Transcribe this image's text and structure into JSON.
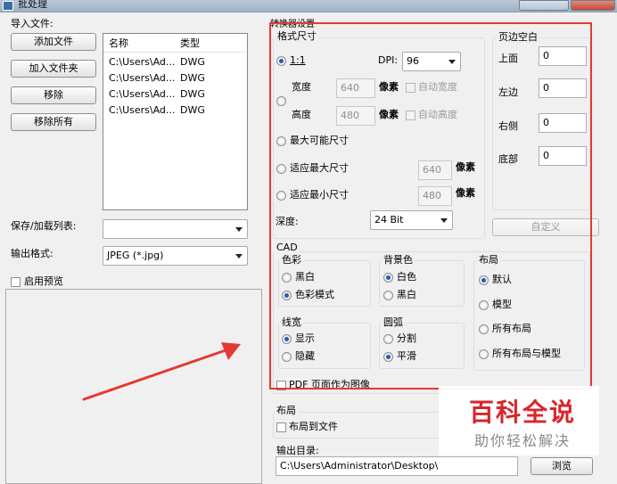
{
  "window": {
    "title": "批处理"
  },
  "left": {
    "import_label": "导入文件:",
    "buttons": {
      "add_file": "添加文件",
      "add_folder": "加入文件夹",
      "remove": "移除",
      "remove_all": "移除所有"
    },
    "list_headers": {
      "name": "名称",
      "type": "类型"
    },
    "files": [
      {
        "name": "C:\\Users\\Ad...",
        "type": "DWG"
      },
      {
        "name": "C:\\Users\\Ad...",
        "type": "DWG"
      },
      {
        "name": "C:\\Users\\Ad...",
        "type": "DWG"
      },
      {
        "name": "C:\\Users\\Ad...",
        "type": "DWG"
      }
    ],
    "save_load_label": "保存/加载列表:",
    "save_load_value": "",
    "output_format_label": "输出格式:",
    "output_format_value": "JPEG (*.jpg)",
    "enable_preview_label": "启用预览"
  },
  "converter": {
    "title": "转换器设置",
    "format_size": {
      "label": "格式尺寸",
      "ratio_label": "1:1",
      "dpi_label": "DPI:",
      "dpi_value": "96",
      "width_label": "宽度",
      "width_value": "640",
      "height_label": "高度",
      "height_value": "480",
      "pixel_label": "像素",
      "auto_width_label": "自动宽度",
      "auto_height_label": "自动高度",
      "max_possible_label": "最大可能尺寸",
      "fit_max_label": "适应最大尺寸",
      "fit_max_value": "640",
      "fit_min_label": "适应最小尺寸",
      "fit_min_value": "480",
      "depth_label": "深度:",
      "depth_value": "24 Bit"
    },
    "margins": {
      "label": "页边空白",
      "top_label": "上面",
      "top_value": "0",
      "left_label": "左边",
      "left_value": "0",
      "right_label": "右侧",
      "right_value": "0",
      "bottom_label": "底部",
      "bottom_value": "0",
      "custom_button": "自定义"
    },
    "cad": {
      "label": "CAD",
      "color": {
        "label": "色彩",
        "options": [
          "黑白",
          "色彩模式"
        ]
      },
      "background": {
        "label": "背景色",
        "options": [
          "白色",
          "黑白"
        ]
      },
      "layout": {
        "label": "布局",
        "options": [
          "默认",
          "模型",
          "所有布局",
          "所有布局与模型"
        ]
      },
      "lineweight": {
        "label": "线宽",
        "options": [
          "显示",
          "隐藏"
        ]
      },
      "arc": {
        "label": "圆弧",
        "options": [
          "分割",
          "平滑"
        ]
      },
      "pdf_as_image_label": "PDF 页面作为图像"
    }
  },
  "bottom": {
    "layout_label": "布局",
    "layout_to_file_label": "布局到文件",
    "output_dir_label": "输出目录:",
    "output_dir_value": "C:\\Users\\Administrator\\Desktop\\",
    "browse_button": "浏览"
  },
  "watermark": {
    "title": "百科全说",
    "subtitle": "助你轻松解决"
  },
  "colors": {
    "highlight_box": "#e53935",
    "arrow": "#e53935",
    "watermark_red": "#d7262c",
    "radio_selected": "#1e5fb4"
  }
}
